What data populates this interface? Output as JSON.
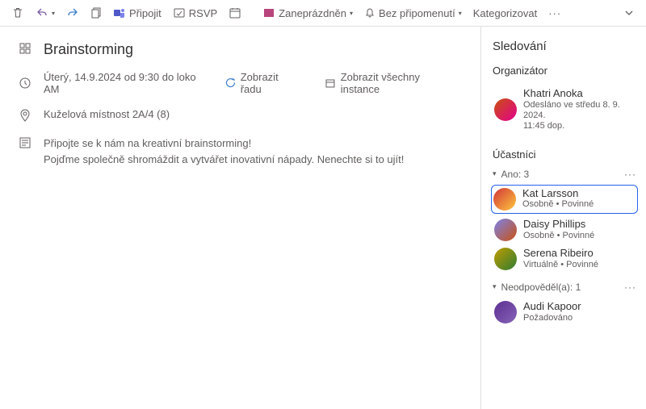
{
  "toolbar": {
    "attach": "Připojit",
    "rsvp": "RSVP",
    "busy": "Zaneprázdněn",
    "reminder": "Bez připomenutí",
    "categorize": "Kategorizovat"
  },
  "event": {
    "title": "Brainstorming",
    "datetime": "Úterý, 14.9.2024 od 9:30 do loko AM",
    "show_series": "Zobrazit řadu",
    "show_all_instances": "Zobrazit všechny instance",
    "location": "Kuželová místnost 2A/4 (8)",
    "description_line1": "Připojte se k nám na kreativní brainstorming!",
    "description_line2": "Pojďme společně shromáždit a vytvářet inovativní nápady. Nenechte si to ujít!"
  },
  "tracking": {
    "heading": "Sledování",
    "organizer_label": "Organizátor",
    "organizer": {
      "name": "Khatri Anoka",
      "sent": "Odesláno ve středu 8. 9. 2024.",
      "sent_time": "11:45 dop."
    },
    "participants_label": "Účastníci",
    "groups": [
      {
        "label": "Ano: 3",
        "people": [
          {
            "name": "Kat Larsson",
            "sub": "Osobně • Povinné",
            "color1": "#d13438",
            "color2": "#ffc83d",
            "selected": true
          },
          {
            "name": "Daisy Phillips",
            "sub": "Osobně • Povinné",
            "color1": "#7b83eb",
            "color2": "#ca5010",
            "selected": false
          },
          {
            "name": "Serena Ribeiro",
            "sub": "Virtuálně • Povinné",
            "color1": "#c19c00",
            "color2": "#2e7d32",
            "selected": false
          }
        ]
      },
      {
        "label": "Neodpověděl(a): 1",
        "people": [
          {
            "name": "Audi Kapoor",
            "sub": "Požadováno",
            "color1": "#5c2e91",
            "color2": "#8764b8",
            "selected": false
          }
        ]
      }
    ]
  }
}
